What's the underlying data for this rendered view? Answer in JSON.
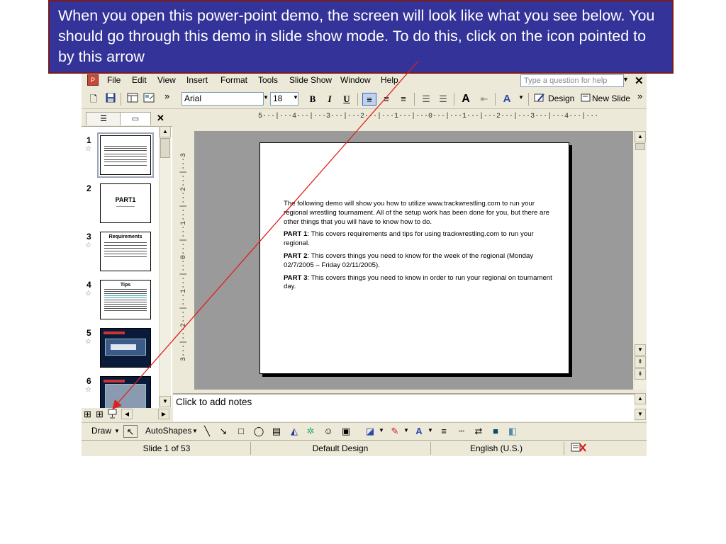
{
  "callout": {
    "text": "When you open this power-point demo, the screen will look like what you see below.  You should go through this demo in slide show mode.  To do this, click on the icon pointed to by this arrow"
  },
  "menubar": {
    "items": [
      "File",
      "Edit",
      "View",
      "Insert",
      "Format",
      "Tools",
      "Slide Show",
      "Window",
      "Help"
    ],
    "help_placeholder": "Type a question for help",
    "close_glyph": "✕"
  },
  "toolbar": {
    "font": "Arial",
    "size": "18",
    "bold": "B",
    "italic": "I",
    "underline": "U",
    "design": "Design",
    "new_slide": "New Slide",
    "overflow": "»"
  },
  "pane": {
    "close_glyph": "✕",
    "slides": [
      {
        "num": "1",
        "title": ""
      },
      {
        "num": "2",
        "title": "PART1"
      },
      {
        "num": "3",
        "title": "Requirements"
      },
      {
        "num": "4",
        "title": "Tips"
      },
      {
        "num": "5",
        "title": ""
      },
      {
        "num": "6",
        "title": ""
      }
    ]
  },
  "ruler": {
    "horizontal": "5···|···4···|···3···|···2···|···1···|···0···|···1···|···2···|···3···|···4···|···",
    "vertical": "3···|···2···|···1···|···0···|···1···|···2···|···3"
  },
  "slide": {
    "intro": "The following demo will show you how to utilize www.trackwrestling.com to run your regional wrestling tournament.  All of the setup work has been done for you, but there are other things that you will have to know how to do.",
    "parts": [
      {
        "label": "PART 1",
        "text": ": This covers requirements and tips for using trackwrestling.com to run your regional."
      },
      {
        "label": "PART 2",
        "text": ": This covers things you need to know for the week of the regional (Monday 02/7/2005 – Friday 02/11/2005)."
      },
      {
        "label": "PART 3",
        "text": ": This covers things you need to know in order to run your regional on tournament day."
      }
    ]
  },
  "notes": {
    "placeholder": "Click to add notes"
  },
  "drawbar": {
    "draw": "Draw",
    "autoshapes": "AutoShapes"
  },
  "statusbar": {
    "slide": "Slide 1 of 53",
    "design": "Default Design",
    "language": "English (U.S.)"
  },
  "colors": {
    "callout_bg": "#333399",
    "arrow": "#e0201c",
    "chrome": "#ece9d8"
  }
}
